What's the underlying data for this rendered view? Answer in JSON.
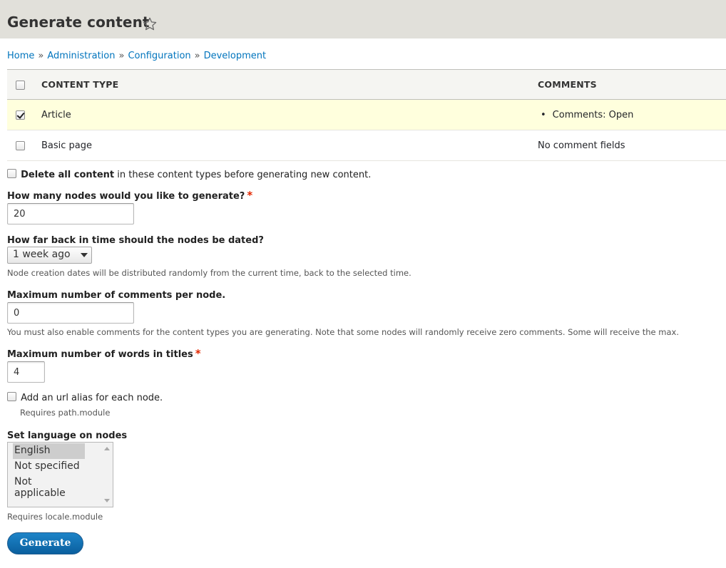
{
  "header": {
    "title": "Generate content",
    "favorite_icon": "star-outline-icon"
  },
  "breadcrumb": [
    {
      "label": "Home"
    },
    {
      "label": "Administration"
    },
    {
      "label": "Configuration"
    },
    {
      "label": "Development"
    }
  ],
  "breadcrumb_separator": "»",
  "content_types": {
    "headers": {
      "type": "CONTENT TYPE",
      "comments": "COMMENTS"
    },
    "rows": [
      {
        "type": "Article",
        "comments": "Comments: Open",
        "checked": true
      },
      {
        "type": "Basic page",
        "comments": "No comment fields",
        "checked": false
      }
    ]
  },
  "delete_all": {
    "bold": "Delete all content",
    "rest": " in these content types before generating new content.",
    "checked": false
  },
  "num_nodes": {
    "label": "How many nodes would you like to generate?",
    "required": "*",
    "value": "20"
  },
  "time_range": {
    "label": "How far back in time should the nodes be dated?",
    "selected": "1 week ago",
    "description": "Node creation dates will be distributed randomly from the current time, back to the selected time."
  },
  "max_comments": {
    "label": "Maximum number of comments per node.",
    "value": "0",
    "description": "You must also enable comments for the content types you are generating. Note that some nodes will randomly receive zero comments. Some will receive the max."
  },
  "title_length": {
    "label": "Maximum number of words in titles",
    "required": "*",
    "value": "4"
  },
  "url_alias": {
    "label": "Add an url alias for each node.",
    "description": "Requires path.module",
    "checked": false
  },
  "language": {
    "label": "Set language on nodes",
    "options": [
      "English",
      "Not specified",
      "Not applicable"
    ],
    "selected": "English",
    "description": "Requires locale.module"
  },
  "actions": {
    "generate_label": "Generate"
  },
  "colors": {
    "header_bg": "#e1e0da",
    "link": "#0074bd",
    "selected_row": "#ffffdd",
    "required": "#e32700",
    "button": "#0a5f9e"
  }
}
